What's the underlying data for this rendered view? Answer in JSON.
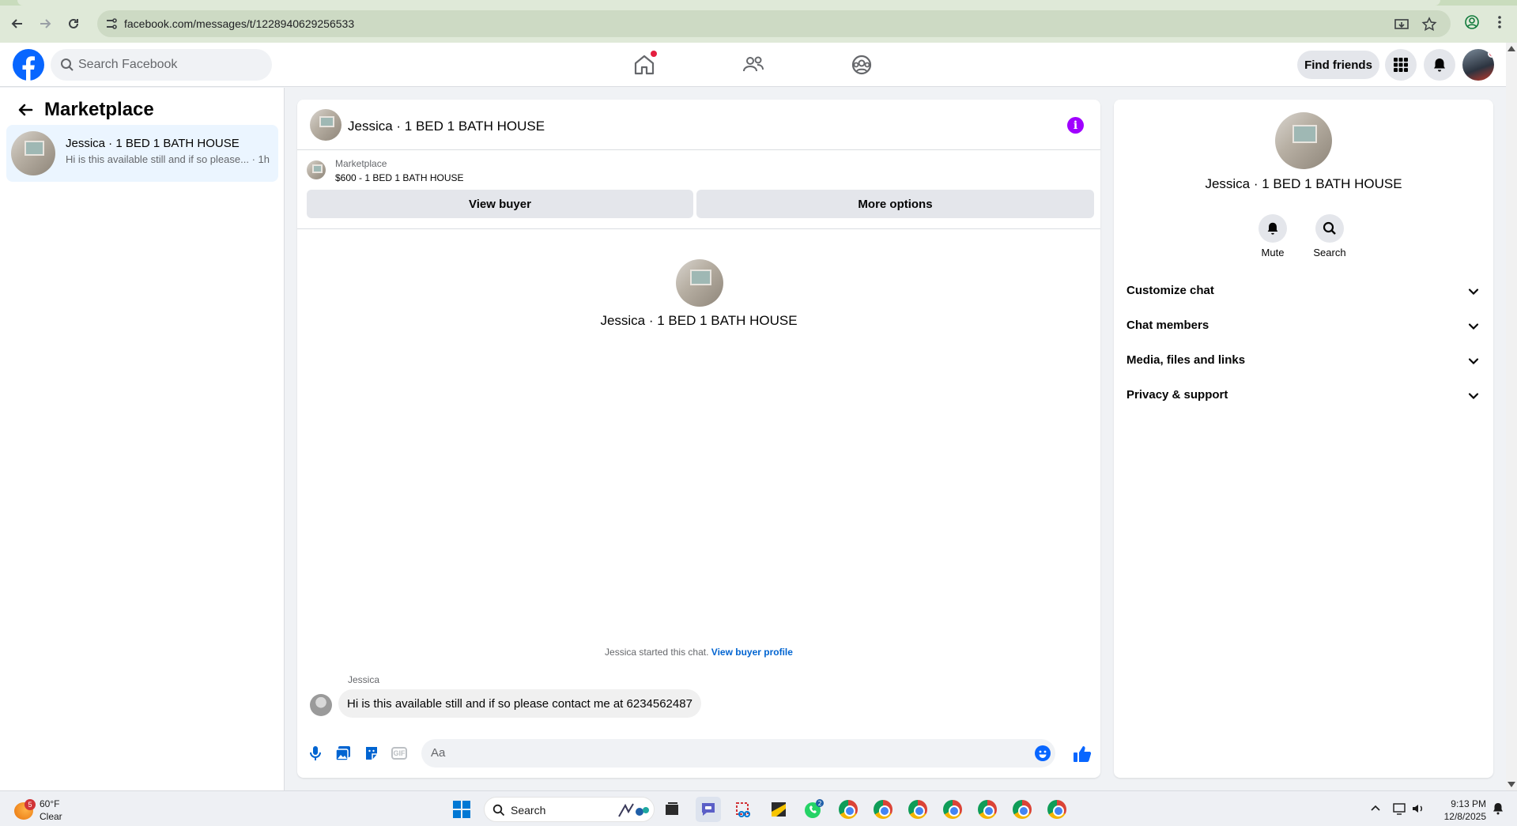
{
  "browser": {
    "url": "facebook.com/messages/t/1228940629256533"
  },
  "header": {
    "search_placeholder": "Search Facebook",
    "find_friends_label": "Find friends"
  },
  "sidebar": {
    "title": "Marketplace",
    "conversations": [
      {
        "name": "Jessica · 1 BED 1 BATH HOUSE",
        "preview": "Hi is this available still and if so please...",
        "time": "· 1h"
      }
    ]
  },
  "chat": {
    "title": "Jessica · 1 BED 1 BATH HOUSE",
    "listing": {
      "source": "Marketplace",
      "title": "$600 - 1 BED 1 BATH HOUSE"
    },
    "view_buyer_label": "View buyer",
    "more_options_label": "More options",
    "profile_name": "Jessica · 1 BED 1 BATH HOUSE",
    "started_text": "Jessica started this chat.",
    "view_buyer_profile_label": "View buyer profile",
    "messages": [
      {
        "sender": "Jessica",
        "text": "Hi is this available still and if so please contact me at 6234562487"
      }
    ],
    "composer_placeholder": "Aa",
    "gif_label": "GIF"
  },
  "info_panel": {
    "name": "Jessica · 1 BED 1 BATH HOUSE",
    "actions": [
      {
        "label": "Mute",
        "icon": "bell-icon"
      },
      {
        "label": "Search",
        "icon": "search-icon"
      }
    ],
    "sections": [
      {
        "label": "Customize chat"
      },
      {
        "label": "Chat members"
      },
      {
        "label": "Media, files and links"
      },
      {
        "label": "Privacy & support"
      }
    ]
  },
  "taskbar": {
    "weather_badge": "5",
    "temperature": "60°F",
    "condition": "Clear",
    "search_label": "Search",
    "whatsapp_badge": "2",
    "time": "9:13 PM",
    "date": "12/8/2025"
  },
  "colors": {
    "facebook_blue": "#0866ff",
    "link_blue": "#0064d1",
    "info_purple": "#a000ff",
    "selected_row": "#ebf5ff",
    "notification_red": "#e41e3f"
  }
}
